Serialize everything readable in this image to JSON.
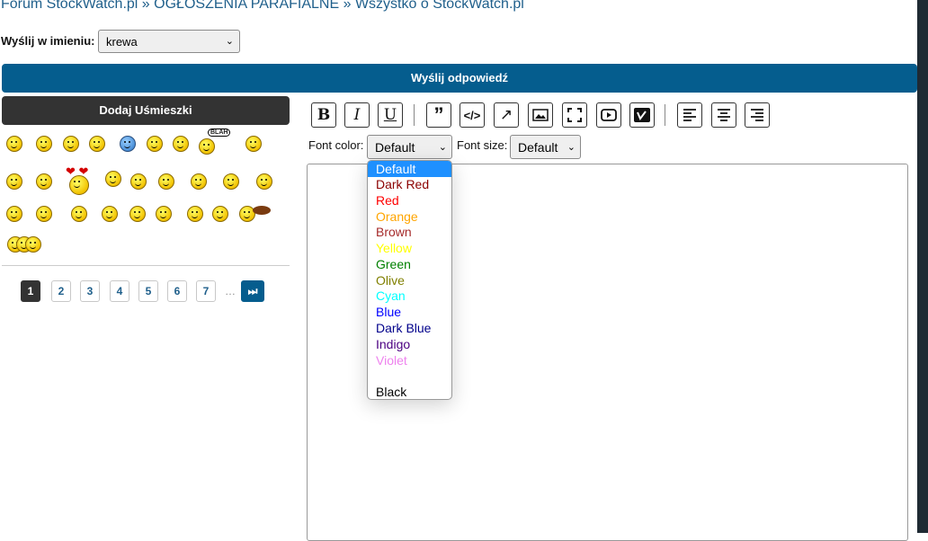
{
  "breadcrumb": {
    "items": [
      "Forum StockWatch.pl",
      "OGŁOSZENIA PARAFIALNE",
      "Wszystko o StockWatch.pl"
    ],
    "separator": "»"
  },
  "sender": {
    "label": "Wyślij w imieniu:",
    "value": "krewa"
  },
  "submit_label": "Wyślij odpowiedź",
  "smileys": {
    "header": "Dodaj Uśmieszki",
    "blah_text": "BLAH"
  },
  "pagination": {
    "pages": [
      "1",
      "2",
      "3",
      "4",
      "5",
      "6",
      "7"
    ],
    "current": "1",
    "ellipsis": "…",
    "last_icon": "⏭"
  },
  "toolbar": {
    "buttons": [
      "bold-icon",
      "italic-icon",
      "underline-icon",
      "quote-icon",
      "code-icon",
      "link-icon",
      "image-icon",
      "fullscreen-icon",
      "youtube-icon",
      "vimeo-icon",
      "align-left-icon",
      "align-center-icon",
      "align-right-icon"
    ]
  },
  "font_color": {
    "label": "Font color:",
    "value": "Default",
    "options": [
      {
        "label": "Default",
        "color": "#ffffff"
      },
      {
        "label": "Dark Red",
        "color": "#8b0000"
      },
      {
        "label": "Red",
        "color": "#ff0000"
      },
      {
        "label": "Orange",
        "color": "#ffa500"
      },
      {
        "label": "Brown",
        "color": "#a52a2a"
      },
      {
        "label": "Yellow",
        "color": "#ffff00"
      },
      {
        "label": "Green",
        "color": "#008000"
      },
      {
        "label": "Olive",
        "color": "#808000"
      },
      {
        "label": "Cyan",
        "color": "#00ffff"
      },
      {
        "label": "Blue",
        "color": "#0000ff"
      },
      {
        "label": "Dark Blue",
        "color": "#00008b"
      },
      {
        "label": "Indigo",
        "color": "#4b0082"
      },
      {
        "label": "Violet",
        "color": "#ee82ee"
      },
      {
        "label": "",
        "color": "#ffffff"
      },
      {
        "label": "Black",
        "color": "#000000"
      }
    ]
  },
  "font_size": {
    "label": "Font size:",
    "value": "Default"
  },
  "colors": {
    "accent": "#055d8e",
    "dark": "#333333",
    "link": "#1f5f8b"
  }
}
